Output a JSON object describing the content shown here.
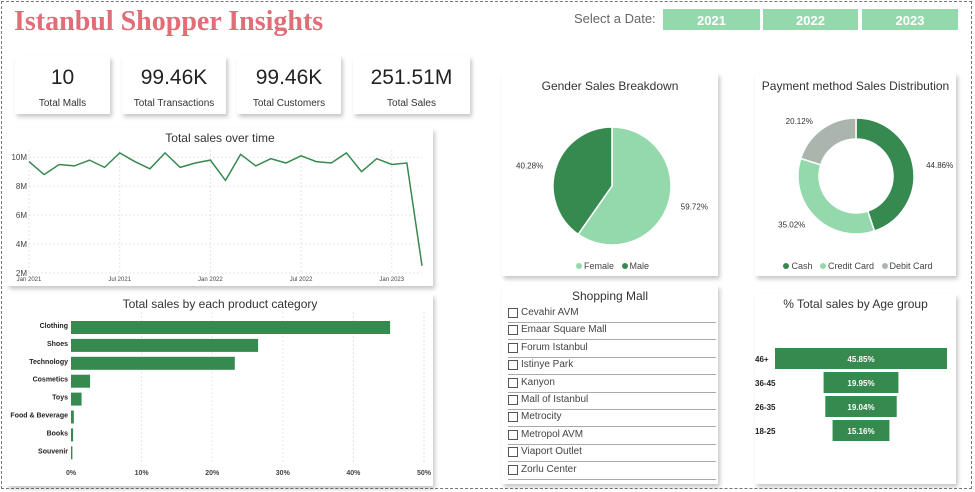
{
  "header": {
    "title": "Istanbul Shopper Insights",
    "date_label": "Select a Date:",
    "years": [
      "2021",
      "2022",
      "2023"
    ]
  },
  "kpis": [
    {
      "value": "10",
      "label": "Total Malls"
    },
    {
      "value": "99.46K",
      "label": "Total Transactions"
    },
    {
      "value": "99.46K",
      "label": "Total Customers"
    },
    {
      "value": "251.51M",
      "label": "Total Sales"
    }
  ],
  "colors": {
    "dark_green": "#36894f",
    "light_green": "#94d9ab",
    "gray": "#aab6ad",
    "title_red": "#e06d78"
  },
  "slicer": {
    "title": "Shopping Mall",
    "malls": [
      "Cevahir AVM",
      "Emaar Square Mall",
      "Forum Istanbul",
      "Istinye Park",
      "Kanyon",
      "Mall of Istanbul",
      "Metrocity",
      "Metropol AVM",
      "Viaport Outlet",
      "Zorlu Center"
    ]
  },
  "chart_data": [
    {
      "type": "line",
      "title": "Total sales over time",
      "y_ticks": [
        "2M",
        "4M",
        "6M",
        "8M",
        "10M"
      ],
      "ylim": [
        2000000,
        10500000
      ],
      "x_ticks": [
        "Jan 2021",
        "Jul 2021",
        "Jan 2022",
        "Jul 2022",
        "Jan 2023"
      ],
      "x": [
        "2021-01",
        "2021-02",
        "2021-03",
        "2021-04",
        "2021-05",
        "2021-06",
        "2021-07",
        "2021-08",
        "2021-09",
        "2021-10",
        "2021-11",
        "2021-12",
        "2022-01",
        "2022-02",
        "2022-03",
        "2022-04",
        "2022-05",
        "2022-06",
        "2022-07",
        "2022-08",
        "2022-09",
        "2022-10",
        "2022-11",
        "2022-12",
        "2023-01",
        "2023-02",
        "2023-03"
      ],
      "values": [
        9700000,
        8800000,
        9500000,
        9400000,
        9800000,
        9300000,
        10300000,
        9700000,
        9200000,
        10300000,
        9300000,
        9600000,
        9800000,
        8400000,
        10200000,
        9400000,
        9900000,
        9600000,
        10100000,
        9700000,
        9600000,
        10300000,
        9000000,
        9900000,
        9500000,
        9600000,
        2500000
      ],
      "grid": true
    },
    {
      "type": "bar",
      "title": "Total sales by each product category",
      "categories": [
        "Clothing",
        "Shoes",
        "Technology",
        "Cosmetics",
        "Toys",
        "Food & Beverage",
        "Books",
        "Souvenir"
      ],
      "values": [
        45.2,
        26.5,
        23.2,
        2.7,
        1.5,
        0.4,
        0.3,
        0.2
      ],
      "x_ticks": [
        "0%",
        "10%",
        "20%",
        "30%",
        "40%",
        "50%"
      ],
      "xlim": [
        0,
        50
      ]
    },
    {
      "type": "pie",
      "title": "Gender Sales Breakdown",
      "series": [
        {
          "name": "Female",
          "value": 59.72,
          "label": "59.72%"
        },
        {
          "name": "Male",
          "value": 40.28,
          "label": "40.28%"
        }
      ],
      "legend_position": "bottom"
    },
    {
      "type": "pie",
      "title": "Payment method Sales Distribution",
      "series": [
        {
          "name": "Cash",
          "value": 44.86,
          "label": "44.86%"
        },
        {
          "name": "Credit Card",
          "value": 35.02,
          "label": "35.02%"
        },
        {
          "name": "Debit Card",
          "value": 20.12,
          "label": "20.12%"
        }
      ],
      "legend_position": "bottom"
    },
    {
      "type": "bar",
      "title": "% Total sales by Age group",
      "categories": [
        "46+",
        "36-45",
        "26-35",
        "18-25"
      ],
      "values": [
        45.85,
        19.95,
        19.04,
        15.16
      ],
      "labels": [
        "45.85%",
        "19.95%",
        "19.04%",
        "15.16%"
      ]
    }
  ]
}
